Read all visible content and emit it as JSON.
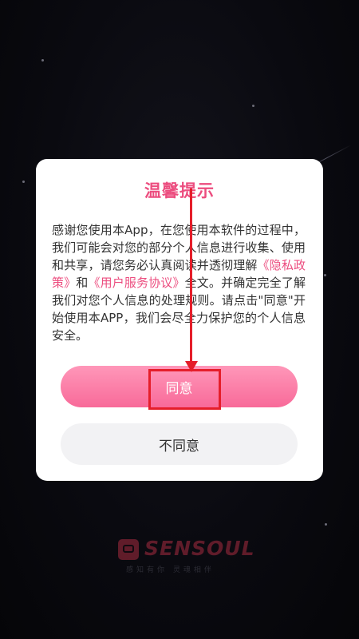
{
  "dialog": {
    "title": "温馨提示",
    "body": {
      "part1": "感谢您使用本App，在您使用本软件的过程中，我们可能会对您的部分个人信息进行收集、使用和共享，请您务必认真阅读并透彻理解",
      "privacy_link": "《隐私政策》",
      "and": "和",
      "agreement_link": "《用户服务协议》",
      "part2": "全文。并确定完全了解我们对您个人信息的处理规则。请点击\"同意\"开始使用本APP，我们会尽全力保护您的个人信息安全。"
    },
    "agree_label": "同意",
    "disagree_label": "不同意"
  },
  "brand": {
    "logo_text": "SENSOUL",
    "tagline": "感知有你  灵魂相伴"
  },
  "colors": {
    "accent": "#ec4d7f",
    "annotation": "#e51e2a"
  }
}
